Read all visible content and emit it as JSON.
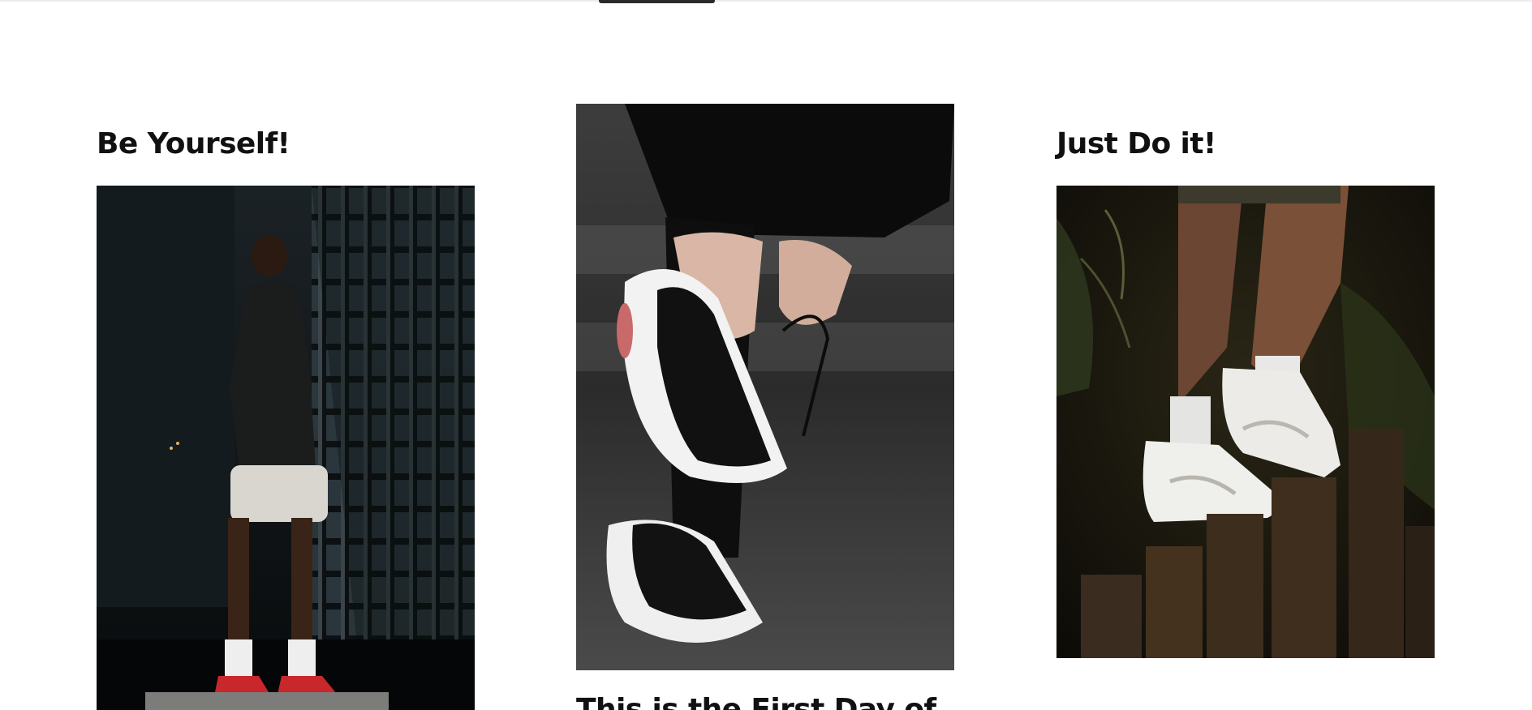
{
  "cards": [
    {
      "title": "Be Yourself!",
      "image_alt": "Man in black t-shirt and white shorts standing in front of a dark building wearing red and white sneakers"
    },
    {
      "title": "This is the First Day of",
      "image_alt": "Hands holding a black and white sneaker while tying laces"
    },
    {
      "title": "Just Do it!",
      "image_alt": "Legs wearing white high-top sneakers stepping on wooden posts in a dark garden"
    }
  ]
}
